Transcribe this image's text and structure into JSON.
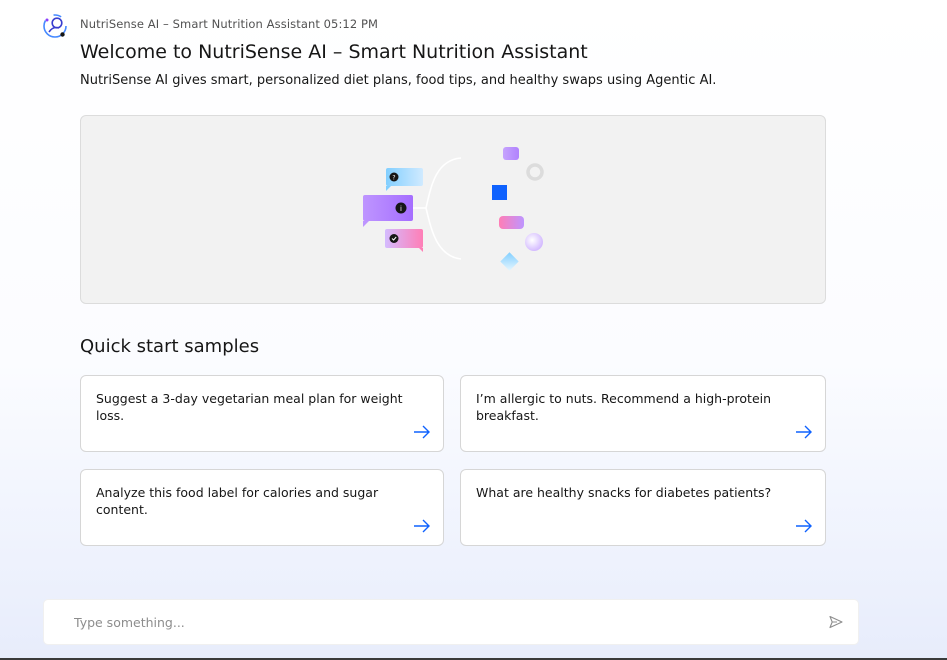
{
  "header": {
    "bot_name": "NutriSense AI – Smart Nutrition Assistant",
    "time": "05:12 PM",
    "avatar_icon": "bot-avatar-icon"
  },
  "welcome": {
    "title": "Welcome to NutriSense AI – Smart Nutrition Assistant",
    "description": "NutriSense AI gives smart, personalized diet plans, food tips, and healthy swaps using Agentic AI."
  },
  "samples": {
    "heading": "Quick start samples",
    "arrow_icon": "arrow-right-icon",
    "items": [
      {
        "text": "Suggest a 3-day vegetarian meal plan for weight loss."
      },
      {
        "text": "I’m allergic to nuts. Recommend a high-protein breakfast."
      },
      {
        "text": "Analyze this food label for calories and sugar content."
      },
      {
        "text": "What are healthy snacks for diabetes patients?"
      }
    ]
  },
  "chat_input": {
    "placeholder": "Type something...",
    "value": "",
    "send_icon": "send-icon"
  },
  "colors": {
    "accent": "#0f62fe",
    "text": "#161616",
    "muted": "#525252",
    "hero_bg": "#f2f2f2"
  }
}
